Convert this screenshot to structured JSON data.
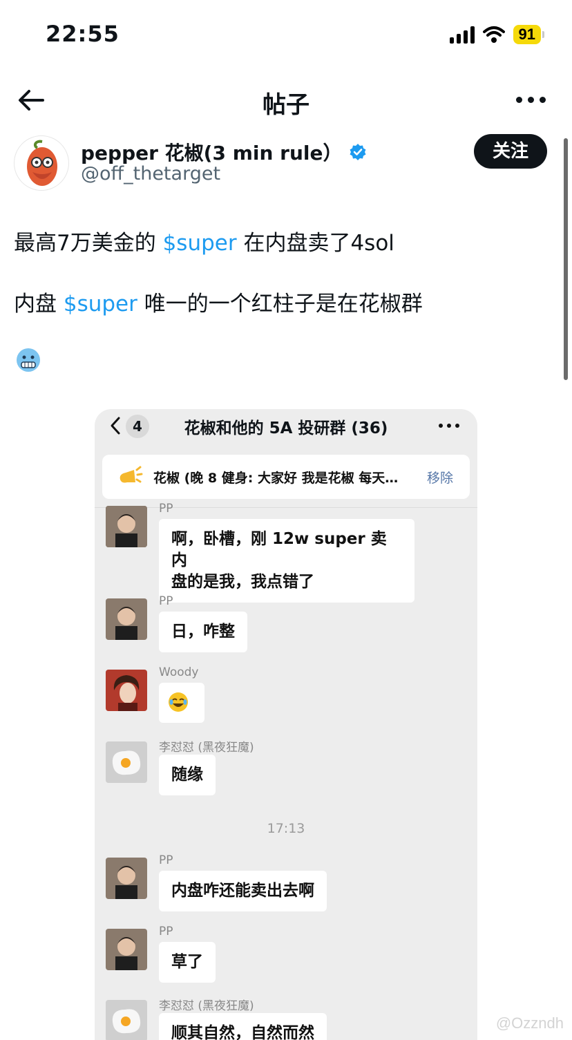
{
  "status_bar": {
    "time": "22:55",
    "battery": "91",
    "icons": [
      "signal-icon",
      "wifi-icon",
      "battery-icon"
    ]
  },
  "nav": {
    "title": "帖子",
    "back_icon": "back-arrow-icon",
    "more_icon": "more-icon"
  },
  "author": {
    "name": "pepper 花椒(3 min rule）",
    "handle": "@off_thetarget",
    "verified_icon": "verified-badge-icon",
    "follow_label": "关注"
  },
  "tweet": {
    "line1": {
      "before": "最高7万美金的 ",
      "cashtag": "$super",
      "after": " 在内盘卖了4sol"
    },
    "line2": {
      "before": "内盘 ",
      "cashtag": "$super",
      "after": " 唯一的一个红柱子是在花椒群"
    },
    "emoji": "cold-face-emoji"
  },
  "embedded_chat": {
    "back_count": "4",
    "title": "花椒和他的 5A 投研群 (36)",
    "pinned": {
      "text": "花椒 (晚 8 健身: 大家好 我是花椒 每天…",
      "remove_label": "移除"
    },
    "messages": [
      {
        "sender": "PP",
        "text_lines": [
          "啊，卧槽，刚 12w super 卖内",
          "盘的是我，我点错了"
        ]
      },
      {
        "sender": "PP",
        "text_lines": [
          "日，咋整"
        ]
      },
      {
        "sender": "Woody",
        "text_lines": [
          ""
        ],
        "emoji": "crying-laughing-emoji"
      },
      {
        "sender": "李怼怼 (黑夜狂魔)",
        "text_lines": [
          "随缘"
        ]
      },
      {
        "sender": "PP",
        "text_lines": [
          "内盘咋还能卖出去啊"
        ]
      },
      {
        "sender": "PP",
        "text_lines": [
          "草了"
        ]
      },
      {
        "sender": "李怼怼 (黑夜狂魔)",
        "text_lines": [
          "顺其自然，自然而然"
        ]
      }
    ],
    "time_divider": "17:13"
  },
  "watermark": "@Ozzndh",
  "colors": {
    "link": "#1d9bf0",
    "follow_bg": "#0f1419",
    "battery": "#f5d90a",
    "chat_bg": "#ededed"
  }
}
